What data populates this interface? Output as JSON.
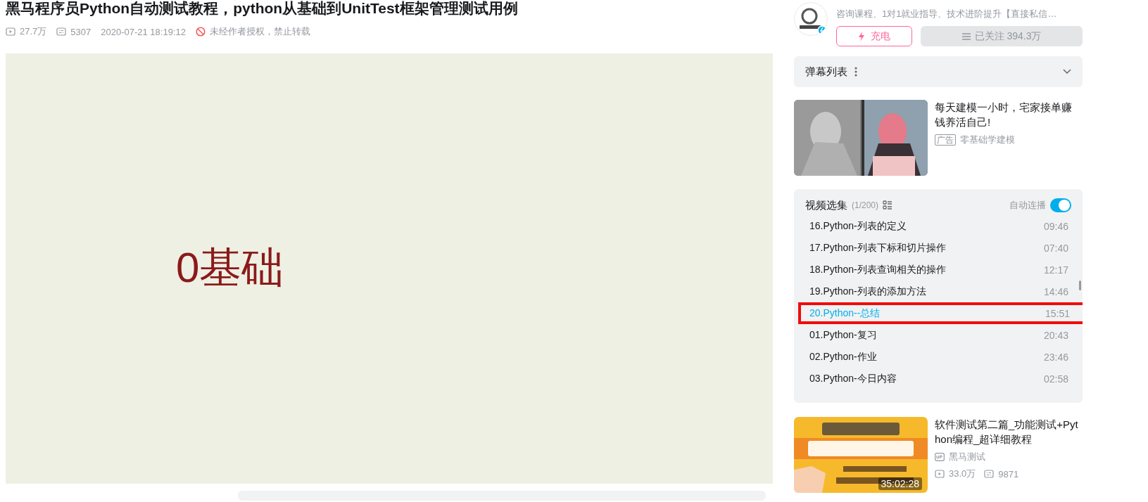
{
  "video": {
    "title": "黑马程序员Python自动测试教程，python从基础到UnitTest框架管理测试用例",
    "views": "27.7万",
    "comments": "5307",
    "date": "2020-07-21 18:19:12",
    "notice": "未经作者授权，禁止转载",
    "slide_text": "0基础"
  },
  "uploader": {
    "bio": "咨询课程、1对1就业指导、技术进阶提升【直接私信…",
    "charge_label": "充电",
    "follow_label": "已关注 394.3万"
  },
  "danmaku": {
    "label": "弹幕列表"
  },
  "ad": {
    "title": "每天建模一小时，宅家接单赚钱养活自己!",
    "tag": "广告",
    "source": "零基础学建模"
  },
  "playlist": {
    "title": "视频选集",
    "count": "(1/200)",
    "autoplay_label": "自动连播",
    "autoplay_on": true,
    "items": [
      {
        "title": "16.Python-列表的定义",
        "duration": "09:46",
        "selected": false,
        "marked": false
      },
      {
        "title": "17.Python-列表下标和切片操作",
        "duration": "07:40",
        "selected": false,
        "marked": false
      },
      {
        "title": "18.Python-列表查询相关的操作",
        "duration": "12:17",
        "selected": false,
        "marked": false
      },
      {
        "title": "19.Python-列表的添加方法",
        "duration": "14:46",
        "selected": false,
        "marked": false
      },
      {
        "title": "20.Python--总结",
        "duration": "15:51",
        "selected": true,
        "marked": true
      },
      {
        "title": "01.Python-复习",
        "duration": "20:43",
        "selected": false,
        "marked": false
      },
      {
        "title": "02.Python-作业",
        "duration": "23:46",
        "selected": false,
        "marked": false
      },
      {
        "title": "03.Python-今日内容",
        "duration": "02:58",
        "selected": false,
        "marked": false
      }
    ]
  },
  "recommendations": [
    {
      "title": "软件测试第二篇_功能测试+Python编程_超详细教程",
      "uploader": "黑马测试",
      "views": "33.0万",
      "comments": "9871",
      "duration": "35:02:28"
    }
  ]
}
